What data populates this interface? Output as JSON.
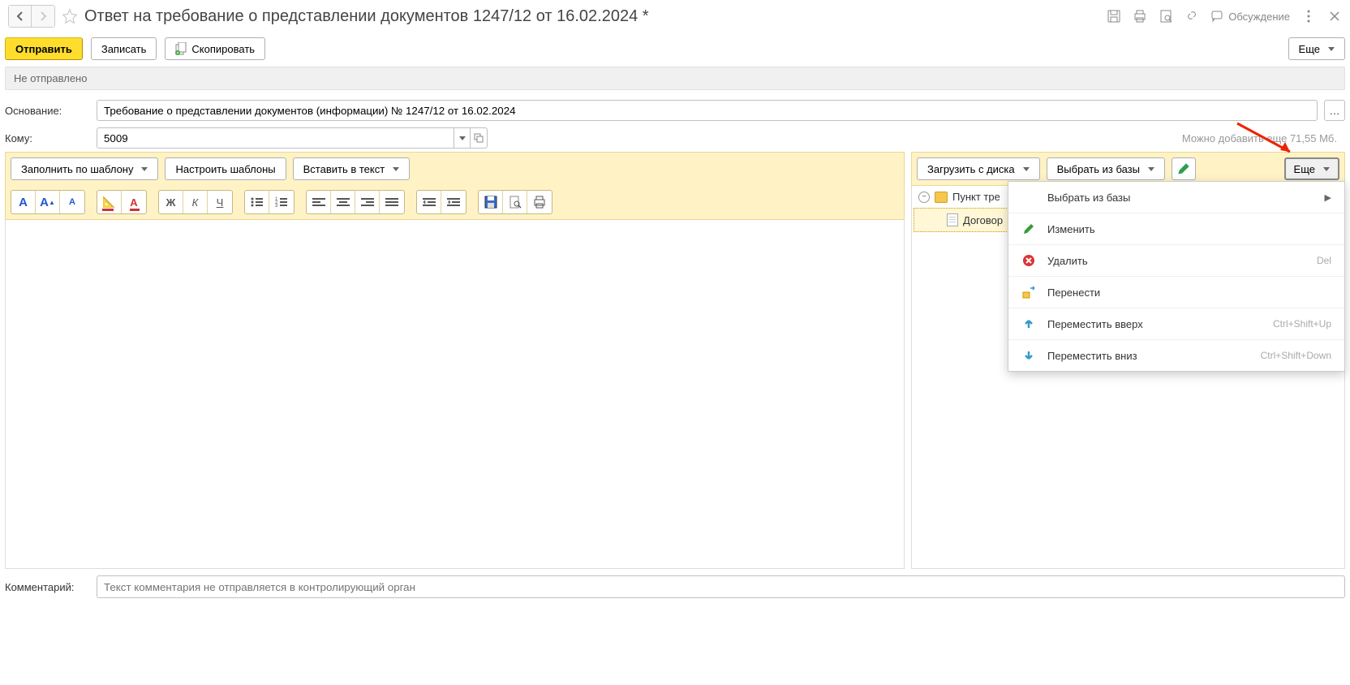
{
  "header": {
    "title": "Ответ на требование о представлении документов 1247/12 от 16.02.2024 *",
    "discuss": "Обсуждение"
  },
  "actions": {
    "send": "Отправить",
    "save": "Записать",
    "copy": "Скопировать",
    "more": "Еще"
  },
  "status": "Не отправлено",
  "form": {
    "basis_label": "Основание:",
    "basis_value": "Требование о представлении документов (информации) № 1247/12 от 16.02.2024",
    "recipient_label": "Кому:",
    "recipient_value": "5009",
    "size_hint": "Можно добавить еще 71,55 Мб."
  },
  "left_toolbar": {
    "fill_template": "Заполнить по шаблону",
    "configure_templates": "Настроить шаблоны",
    "insert_text": "Вставить в текст"
  },
  "right_toolbar": {
    "load_disk": "Загрузить с диска",
    "select_base": "Выбрать из базы",
    "more": "Еще"
  },
  "tree": {
    "root": "Пункт тре",
    "child": "Договор"
  },
  "menu": {
    "select_base": "Выбрать из базы",
    "edit": "Изменить",
    "delete": "Удалить",
    "delete_key": "Del",
    "move": "Перенести",
    "move_up": "Переместить вверх",
    "move_up_key": "Ctrl+Shift+Up",
    "move_down": "Переместить вниз",
    "move_down_key": "Ctrl+Shift+Down"
  },
  "comment": {
    "label": "Комментарий:",
    "placeholder": "Текст комментария не отправляется в контролирующий орган"
  }
}
